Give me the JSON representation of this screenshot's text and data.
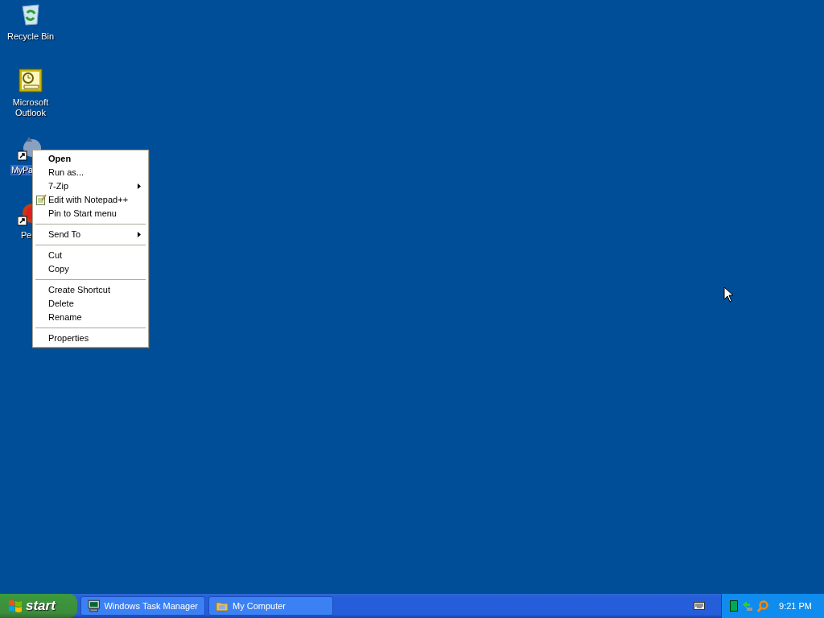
{
  "desktop_icons": [
    {
      "label": "Recycle Bin",
      "selected": false
    },
    {
      "label": "Microsoft Outlook",
      "selected": false
    },
    {
      "label": "MyPa",
      "selected": true
    },
    {
      "label": "Pe",
      "selected": false
    }
  ],
  "context_menu": {
    "items": [
      {
        "kind": "item",
        "label": "Open",
        "default": true,
        "submenu": false
      },
      {
        "kind": "item",
        "label": "Run as...",
        "default": false,
        "submenu": false
      },
      {
        "kind": "item",
        "label": "7-Zip",
        "default": false,
        "submenu": true
      },
      {
        "kind": "item",
        "label": "Edit with Notepad++",
        "default": false,
        "submenu": false,
        "icon": true
      },
      {
        "kind": "item",
        "label": "Pin to Start menu",
        "default": false,
        "submenu": false
      },
      {
        "kind": "separator"
      },
      {
        "kind": "item",
        "label": "Send To",
        "default": false,
        "submenu": true
      },
      {
        "kind": "separator"
      },
      {
        "kind": "item",
        "label": "Cut",
        "default": false,
        "submenu": false
      },
      {
        "kind": "item",
        "label": "Copy",
        "default": false,
        "submenu": false
      },
      {
        "kind": "separator"
      },
      {
        "kind": "item",
        "label": "Create Shortcut",
        "default": false,
        "submenu": false
      },
      {
        "kind": "item",
        "label": "Delete",
        "default": false,
        "submenu": false
      },
      {
        "kind": "item",
        "label": "Rename",
        "default": false,
        "submenu": false
      },
      {
        "kind": "separator"
      },
      {
        "kind": "item",
        "label": "Properties",
        "default": false,
        "submenu": false
      }
    ]
  },
  "taskbar": {
    "start_button": "start",
    "tasks": [
      {
        "label": "Windows Task Manager",
        "kind": "monitor"
      },
      {
        "label": "My Computer",
        "kind": "folder"
      }
    ],
    "clock": "9:21 PM"
  }
}
